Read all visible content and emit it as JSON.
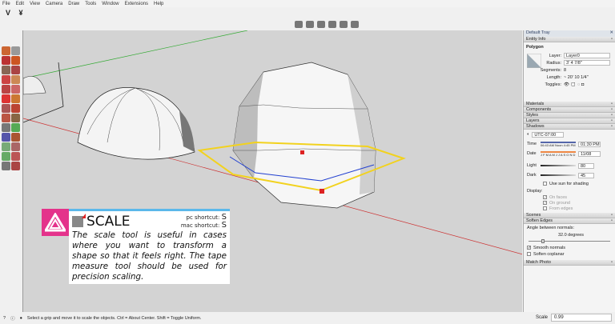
{
  "menu": [
    "File",
    "Edit",
    "View",
    "Camera",
    "Draw",
    "Tools",
    "Window",
    "Extensions",
    "Help"
  ],
  "tray": {
    "title": "Default Tray",
    "entity_info": {
      "header": "Entity Info",
      "type": "Polygon",
      "layer_label": "Layer:",
      "layer": "Layer0",
      "radius_label": "Radius:",
      "radius": "3' 4 7/8\"",
      "segments_label": "Segments:",
      "segments": "8",
      "length_label": "Length:",
      "length": "~ 20' 10 1/4\"",
      "toggles_label": "Toggles:"
    },
    "sections": [
      "Materials",
      "Components",
      "Styles",
      "Layers",
      "Shadows"
    ],
    "shadows": {
      "timezone": "UTC-07:00",
      "time_label": "Time",
      "time_scale": "06:43 AM  Noon  4:45 PM",
      "time": "01:30 PM",
      "date_label": "Date",
      "date_scale": "J F M A M J J A S O N D",
      "date": "11/08",
      "light_label": "Light",
      "light": "80",
      "dark_label": "Dark",
      "dark": "45",
      "use_sun": "Use sun for shading",
      "display_label": "Display:",
      "on_faces": "On faces",
      "on_ground": "On ground",
      "from_edges": "From edges"
    },
    "scenes": "Scenes",
    "soften": {
      "header": "Soften Edges",
      "angle_label": "Angle between normals:",
      "angle": "32.0  degrees",
      "smooth": "Smooth normals",
      "coplanar": "Soften coplanar"
    },
    "match_photo": "Match Photo"
  },
  "card": {
    "title": "SCALE",
    "pc_label": "pc shortcut:",
    "pc_key": "S",
    "mac_label": "mac shortcut:",
    "mac_key": "S",
    "description": "The scale tool is useful in cases where you want to transform a shape so that it feels right. The tape measure tool should be used for precision scaling."
  },
  "status": {
    "message": "Select a grip and move it to scale the objects. Ctrl = About Center. Shift = Toggle Uniform.",
    "scale_label": "Scale",
    "scale_value": "0.99"
  },
  "colors": {
    "accent": "#e4338b",
    "card_border": "#5bb8ea",
    "selection": "#f2d21e"
  }
}
